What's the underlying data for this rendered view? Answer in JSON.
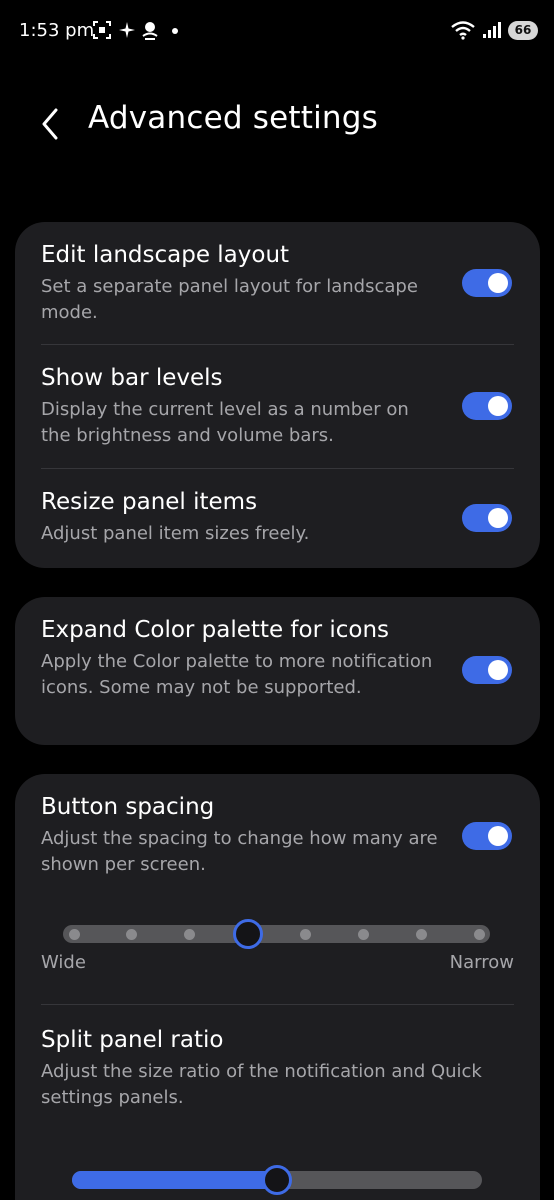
{
  "status_bar": {
    "time": "1:53 pm",
    "battery": "66"
  },
  "header": {
    "title": "Advanced settings"
  },
  "card1": {
    "items": [
      {
        "title": "Edit landscape layout",
        "description": "Set a separate panel layout for landscape mode.",
        "enabled": true
      },
      {
        "title": "Show bar levels",
        "description": "Display the current level as a number on the brightness and volume bars.",
        "enabled": true
      },
      {
        "title": "Resize panel items",
        "description": "Adjust panel item sizes freely.",
        "enabled": true
      }
    ]
  },
  "card2": {
    "items": [
      {
        "title": "Expand Color palette for icons",
        "description": "Apply the Color palette to more notification icons. Some may not be supported.",
        "enabled": true
      }
    ]
  },
  "card3": {
    "button_spacing": {
      "title": "Button spacing",
      "description": "Adjust the spacing to change how many are shown per screen.",
      "enabled": true,
      "slider": {
        "steps": 8,
        "selected_index": 3,
        "min_label": "Wide",
        "max_label": "Narrow"
      }
    },
    "split_panel": {
      "title": "Split panel ratio",
      "description": "Adjust the size ratio of the notification and Quick settings panels.",
      "ratio": 0.5
    }
  },
  "colors": {
    "accent": "#3e6be6",
    "card_background": "#1e1e21",
    "background": "#000000"
  }
}
